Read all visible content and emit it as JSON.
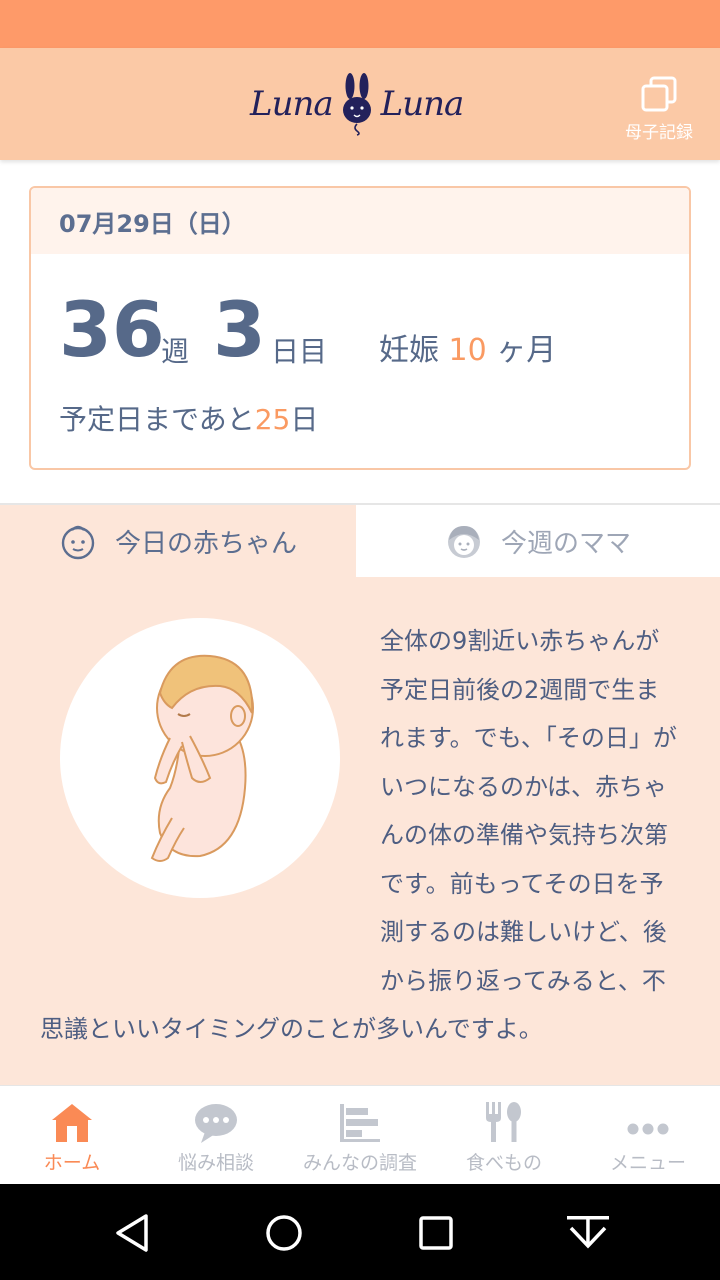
{
  "app": {
    "logo_left": "Luna",
    "logo_right": "Luna",
    "record_label": "母子記録"
  },
  "pregnancy": {
    "date": "07月29日（日）",
    "weeks": "36",
    "weeks_unit": "週",
    "days": "3",
    "days_unit": "日目",
    "month_prefix": "妊娠",
    "month": "10",
    "month_suffix": "ヶ月",
    "remaining_prefix": "予定日まであと",
    "remaining_days": "25",
    "remaining_suffix": "日"
  },
  "tabs": [
    {
      "label": "今日の赤ちゃん",
      "icon": "baby-face-icon",
      "active": true
    },
    {
      "label": "今週のママ",
      "icon": "mama-face-icon",
      "active": false
    }
  ],
  "article": {
    "text": "全体の9割近い赤ちゃんが予定日前後の2週間で生まれます。でも、「その日」がいつになるのかは、赤ちゃんの体の準備や気持ち次第です。前もってその日を予測するのは難しいけど、後から振り返ってみると、不思議といいタイミングのことが多いんですよ。",
    "illustration": "fetus-illustration"
  },
  "bottom_nav": [
    {
      "label": "ホーム",
      "icon": "home-icon",
      "active": true
    },
    {
      "label": "悩み相談",
      "icon": "chat-bubble-icon",
      "active": false
    },
    {
      "label": "みんなの調査",
      "icon": "bar-chart-icon",
      "active": false
    },
    {
      "label": "食べもの",
      "icon": "fork-spoon-icon",
      "active": false
    },
    {
      "label": "メニュー",
      "icon": "more-dots-icon",
      "active": false
    }
  ],
  "colors": {
    "status_bar": "#fe9a69",
    "app_bar": "#fbc9a6",
    "accent": "#fa9a62",
    "text_primary": "#566989",
    "content_bg": "#fde6d9"
  }
}
